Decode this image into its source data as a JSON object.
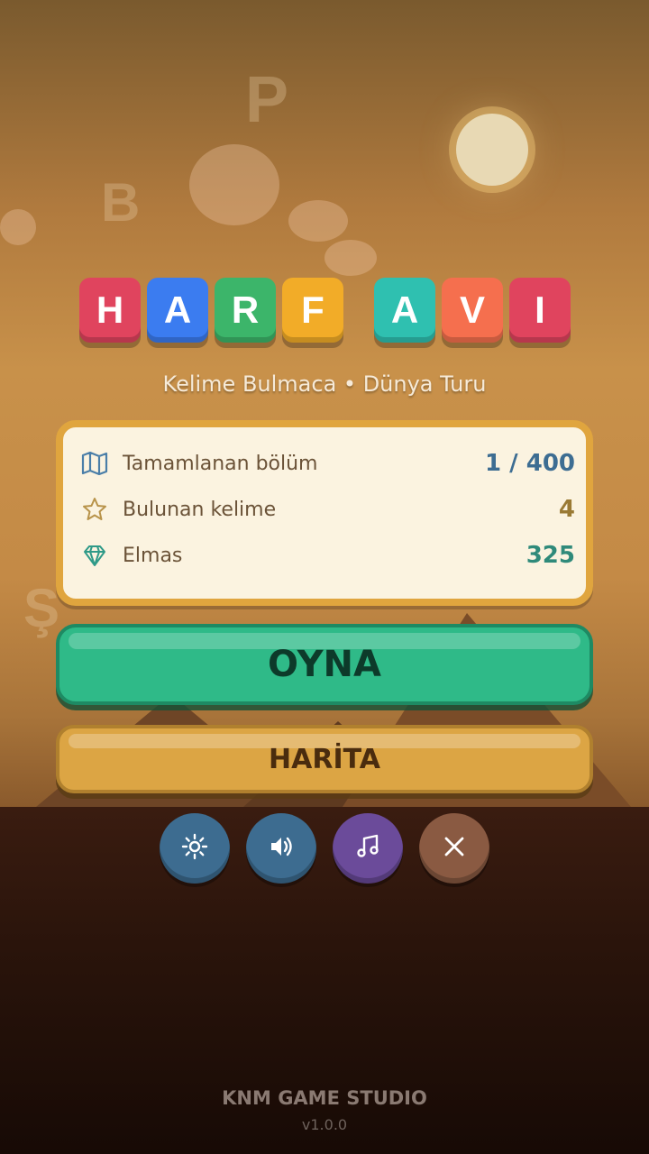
{
  "title": {
    "tiles": [
      {
        "letter": "H",
        "color": "#e0445e"
      },
      {
        "letter": "A",
        "color": "#3b7cf0"
      },
      {
        "letter": "R",
        "color": "#3cb56a"
      },
      {
        "letter": "F",
        "color": "#f2ac28"
      },
      {
        "letter": "A",
        "color": "#2fc0b0"
      },
      {
        "letter": "V",
        "color": "#f56f4e"
      },
      {
        "letter": "I",
        "color": "#e0445e"
      }
    ],
    "subtitle": "Kelime Bulmaca • Dünya Turu"
  },
  "stats": {
    "completed": {
      "label": "Tamamlanan bölüm",
      "value": "1 / 400",
      "icon": "map-icon",
      "color": "#3d6d92"
    },
    "words": {
      "label": "Bulunan kelime",
      "value": "4",
      "icon": "star-icon",
      "color": "#9a7a34"
    },
    "diamonds": {
      "label": "Elmas",
      "value": "325",
      "icon": "diamond-icon",
      "color": "#2f8a7a"
    }
  },
  "buttons": {
    "play": "OYNA",
    "map": "HARİTA"
  },
  "round_buttons": [
    {
      "icon": "settings-icon",
      "color": "#3d6c90"
    },
    {
      "icon": "volume-icon",
      "color": "#3d6c90"
    },
    {
      "icon": "music-icon",
      "color": "#6b4b9a"
    },
    {
      "icon": "close-icon",
      "color": "#8a5a42"
    }
  ],
  "footer": {
    "studio": "KNM GAME STUDIO",
    "version": "v1.0.0"
  }
}
